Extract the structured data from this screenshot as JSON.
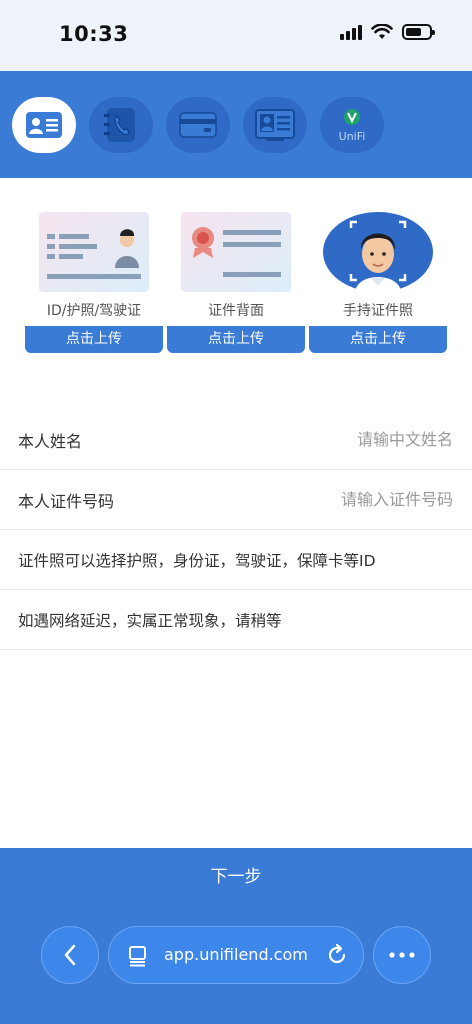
{
  "status_bar": {
    "time": "10:33"
  },
  "steps": [
    {
      "name": "id-card",
      "active": true
    },
    {
      "name": "phone-book",
      "active": false
    },
    {
      "name": "bank-card",
      "active": false
    },
    {
      "name": "work-badge",
      "active": false
    },
    {
      "name": "unifi-logo",
      "active": false,
      "logo_text": "UniFi"
    }
  ],
  "uploads": [
    {
      "label": "ID/护照/驾驶证",
      "button": "点击上传"
    },
    {
      "label": "证件背面",
      "button": "点击上传"
    },
    {
      "label": "手持证件照",
      "button": "点击上传"
    }
  ],
  "form": {
    "name": {
      "label": "本人姓名",
      "placeholder": "请输中文姓名",
      "value": ""
    },
    "id_number": {
      "label": "本人证件号码",
      "placeholder": "请输入证件号码",
      "value": ""
    }
  },
  "notes": [
    "证件照可以选择护照，身份证，驾驶证，保障卡等ID",
    "如遇网络延迟，实属正常现象，请稍等"
  ],
  "next_button": "下一步",
  "browser": {
    "url": "app.unifilend.com"
  },
  "colors": {
    "primary": "#3a7bd5",
    "step_inactive": "#2f6ac6"
  }
}
